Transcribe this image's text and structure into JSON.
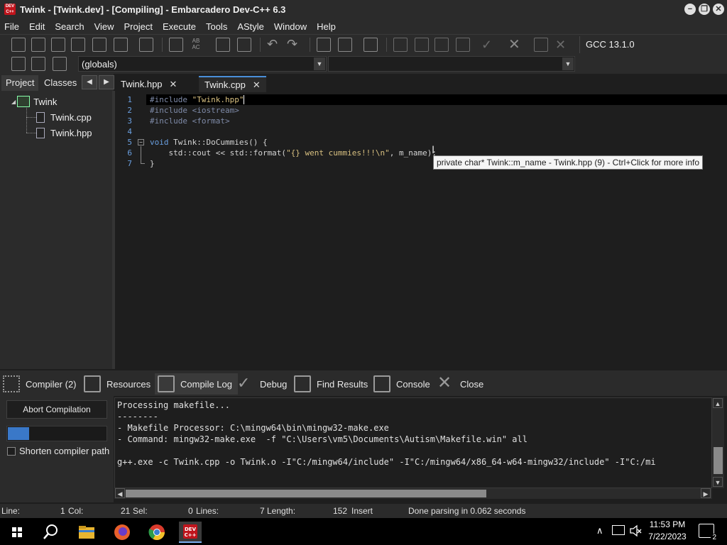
{
  "window": {
    "title": "Twink - [Twink.dev] - [Compiling] - Embarcadero Dev-C++ 6.3",
    "app_icon_text": "DEV C++",
    "minimize": "−",
    "restore": "❐",
    "close": "✕"
  },
  "menu": [
    "File",
    "Edit",
    "Search",
    "View",
    "Project",
    "Execute",
    "Tools",
    "AStyle",
    "Window",
    "Help"
  ],
  "toolbar": {
    "compiler": "GCC 13.1.0",
    "scope_combo": "(globals)",
    "combo_arrow": "▼"
  },
  "left_panel": {
    "tabs": [
      "Project",
      "Classes"
    ],
    "prev": "◀",
    "next": "▶",
    "tree": {
      "root": "Twink",
      "files": [
        "Twink.cpp",
        "Twink.hpp"
      ]
    }
  },
  "editor": {
    "tabs": [
      {
        "label": "Twink.hpp",
        "close": "✕"
      },
      {
        "label": "Twink.cpp",
        "close": "✕"
      }
    ],
    "line_numbers": [
      "1",
      "2",
      "3",
      "4",
      "5",
      "6",
      "7"
    ],
    "fold_minus": "−",
    "lines": {
      "l1_pp": "#include ",
      "l1_str": "\"Twink.hpp\"",
      "l2": "#include <iostream>",
      "l3": "#include <format>",
      "l5_kw": "void ",
      "l5_rest": "Twink::DoCummies() {",
      "l6_a": "    std::cout << std::format(",
      "l6_str": "\"{} went cummies!!!\\n\"",
      "l6_b": ", m_name);",
      "l7": "}"
    },
    "tooltip": "private char* Twink::m_name - Twink.hpp (9) - Ctrl+Click for more info",
    "cursor_glyph": "I"
  },
  "bottom_tabs": [
    "Compiler (2)",
    "Resources",
    "Compile Log",
    "Debug",
    "Find Results",
    "Console",
    "Close"
  ],
  "compile": {
    "abort_label": "Abort Compilation",
    "progress": 0.22,
    "shorten_label": "Shorten compiler path",
    "log": [
      "Processing makefile...",
      "--------",
      "- Makefile Processor: C:\\mingw64\\bin\\mingw32-make.exe",
      "- Command: mingw32-make.exe  -f \"C:\\Users\\vm5\\Documents\\Autism\\Makefile.win\" all",
      "",
      "g++.exe -c Twink.cpp -o Twink.o -I\"C:/mingw64/include\" -I\"C:/mingw64/x86_64-w64-mingw32/include\" -I\"C:/mi"
    ],
    "arrow_up": "▲",
    "arrow_down": "▼",
    "arrow_left": "◀",
    "arrow_right": "▶"
  },
  "status": {
    "line_label": "Line:",
    "line_value": "1",
    "col_label": "Col:",
    "col_value": "21",
    "sel_label": "Sel:",
    "sel_value": "0",
    "lines_label": "Lines:",
    "lines_value": "7",
    "length_label": "Length:",
    "length_value": "152",
    "mode": "Insert",
    "message": "Done parsing in 0.062 seconds"
  },
  "taskbar": {
    "time": "11:53 PM",
    "date": "7/22/2023",
    "notification_count": "2",
    "chevron": "∧"
  }
}
